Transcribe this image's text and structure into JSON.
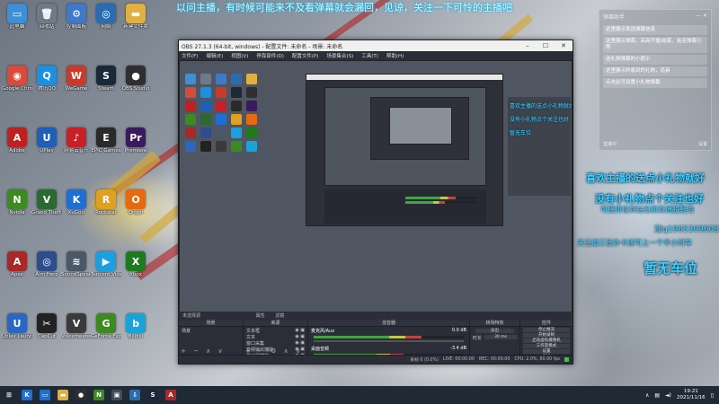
{
  "desktop": {
    "icons": [
      {
        "label": "此电脑",
        "glyph": "▭",
        "color": "#3d8fd6"
      },
      {
        "label": "回收站",
        "glyph": "🗑",
        "color": "#6d7a88"
      },
      {
        "label": "控制面板",
        "glyph": "⚙",
        "color": "#3f79c9"
      },
      {
        "label": "网络",
        "glyph": "◎",
        "color": "#2b6cb0"
      },
      {
        "label": "新建文件夹",
        "glyph": "▬",
        "color": "#e0b040"
      },
      {
        "label": "Google Chrome",
        "glyph": "◉",
        "color": "#d64b3a"
      },
      {
        "label": "腾讯QQ",
        "glyph": "Q",
        "color": "#1d8fe0"
      },
      {
        "label": "WeGame",
        "glyph": "W",
        "color": "#c93a2b"
      },
      {
        "label": "Steam",
        "glyph": "S",
        "color": "#1b2838"
      },
      {
        "label": "OBS Studio",
        "glyph": "●",
        "color": "#302e31"
      },
      {
        "label": "Adobe",
        "glyph": "A",
        "color": "#c0201f"
      },
      {
        "label": "UPlay",
        "glyph": "U",
        "color": "#1f5fb8"
      },
      {
        "label": "网易云音乐",
        "glyph": "♪",
        "color": "#c91f27"
      },
      {
        "label": "EPIC Games",
        "glyph": "E",
        "color": "#2a2a2a"
      },
      {
        "label": "Premiere",
        "glyph": "Pr",
        "color": "#3a1a5c"
      },
      {
        "label": "Nvidia",
        "glyph": "N",
        "color": "#3d8a1f"
      },
      {
        "label": "Grand Theft Auto V",
        "glyph": "V",
        "color": "#2a6a30"
      },
      {
        "label": "KuGou",
        "glyph": "K",
        "color": "#1d6fd6"
      },
      {
        "label": "Rockstar",
        "glyph": "R",
        "color": "#e0a020"
      },
      {
        "label": "Origin",
        "glyph": "O",
        "color": "#e56a10"
      },
      {
        "label": "Apex",
        "glyph": "A",
        "color": "#a92828"
      },
      {
        "label": "Aim Hero",
        "glyph": "◎",
        "color": "#2e4d8f"
      },
      {
        "label": "SoundSpeak",
        "glyph": "≋",
        "color": "#4a5868"
      },
      {
        "label": "Tencent Video",
        "glyph": "▶",
        "color": "#1aa0e0"
      },
      {
        "label": "Xbox",
        "glyph": "X",
        "color": "#1f7a1f"
      },
      {
        "label": "Uplay Launcher",
        "glyph": "U",
        "color": "#2b66c2"
      },
      {
        "label": "CapCut",
        "glyph": "✂",
        "color": "#222"
      },
      {
        "label": "Voicemeeter Banana",
        "glyph": "V",
        "color": "#3a3a3a"
      },
      {
        "label": "GeForce Experience",
        "glyph": "G",
        "color": "#3d8a1f"
      },
      {
        "label": "Bilibili",
        "glyph": "b",
        "color": "#1aa3d9"
      }
    ]
  },
  "danmaku": {
    "top_scroll": "以问主播，有时候可能来不及看弹幕就会漏回，见谅，关注一下可怜的主播吧",
    "line1": "喜欢主播的送点小礼物就好",
    "line2": "没有小礼物点个关注也好",
    "line3": "可接排位到钻石和双通脱鞋海",
    "line4": "加q1965309608",
    "line5": "关注加三张办卡送可上一个半小时车",
    "line6": "暂无车位"
  },
  "chat_panel": {
    "header_left": "弹幕助手",
    "header_right": "— ✕",
    "messages": [
      "这里展示发送弹幕信息",
      "这里展示弹幕，高亮开播/结束，粘连弹幕行等",
      "送礼物弹幕的小提示",
      "这里展示的收到的礼物，道具",
      "点击此可设置小礼物弹幕"
    ],
    "footer_left": "直播中",
    "footer_right": "设置"
  },
  "obs": {
    "title": "OBS 27.1.3 (64-bit, windows) - 配置文件: 未命名 - 场景: 未命名",
    "menu": [
      "文件(F)",
      "编辑(E)",
      "视图(V)",
      "停靠部件(D)",
      "配置文件(P)",
      "场景集合(S)",
      "工具(T)",
      "帮助(H)"
    ],
    "preview_label": "未选择源",
    "properties_label": "属性",
    "filters_label": "滤镜",
    "docks": {
      "scenes": {
        "title": "场景",
        "items": [
          "场景"
        ]
      },
      "sources": {
        "title": "来源",
        "items": [
          "文本框",
          "文本",
          "窗口采集",
          "音频输出捕获",
          "显示器捕获"
        ]
      },
      "mixer": {
        "title": "混音器",
        "channels": [
          {
            "name": "麦克风/Aux",
            "db": "0.0 dB",
            "level": 0.72
          },
          {
            "name": "桌面音频",
            "db": "-3.4 dB",
            "level": 0.6
          }
        ]
      },
      "transitions": {
        "title": "转场特效",
        "type": "淡出",
        "duration_label": "时长",
        "duration": "30 ms"
      },
      "controls": {
        "title": "控件",
        "buttons": [
          "停止推流",
          "开始录制",
          "启动虚拟摄像机",
          "工作室模式",
          "设置",
          "退出"
        ]
      }
    },
    "status": {
      "dropped": "丢帧 0 (0.0%)",
      "live": "LIVE: 00:00:00",
      "rec": "REC: 00:00:00",
      "cpu": "CPU: 2.0%, 60.00 fps"
    }
  },
  "taskbar": {
    "apps": [
      {
        "glyph": "⊞",
        "color": "#1f2a36",
        "name": "start"
      },
      {
        "glyph": "K",
        "color": "#1d6fd6",
        "name": "kugou"
      },
      {
        "glyph": "▭",
        "color": "#1d6fd6",
        "name": "tencent"
      },
      {
        "glyph": "▬",
        "color": "#e0b040",
        "name": "explorer"
      },
      {
        "glyph": "●",
        "color": "#302e31",
        "name": "obs"
      },
      {
        "glyph": "N",
        "color": "#3d8a1f",
        "name": "nvidia"
      },
      {
        "glyph": "▣",
        "color": "#444c56",
        "name": "app"
      },
      {
        "glyph": "⇩",
        "color": "#2b6cb0",
        "name": "download"
      },
      {
        "glyph": "S",
        "color": "#1b2838",
        "name": "steam"
      },
      {
        "glyph": "A",
        "color": "#a92828",
        "name": "apex"
      }
    ],
    "time": "19:21",
    "date": "2021/11/16"
  }
}
